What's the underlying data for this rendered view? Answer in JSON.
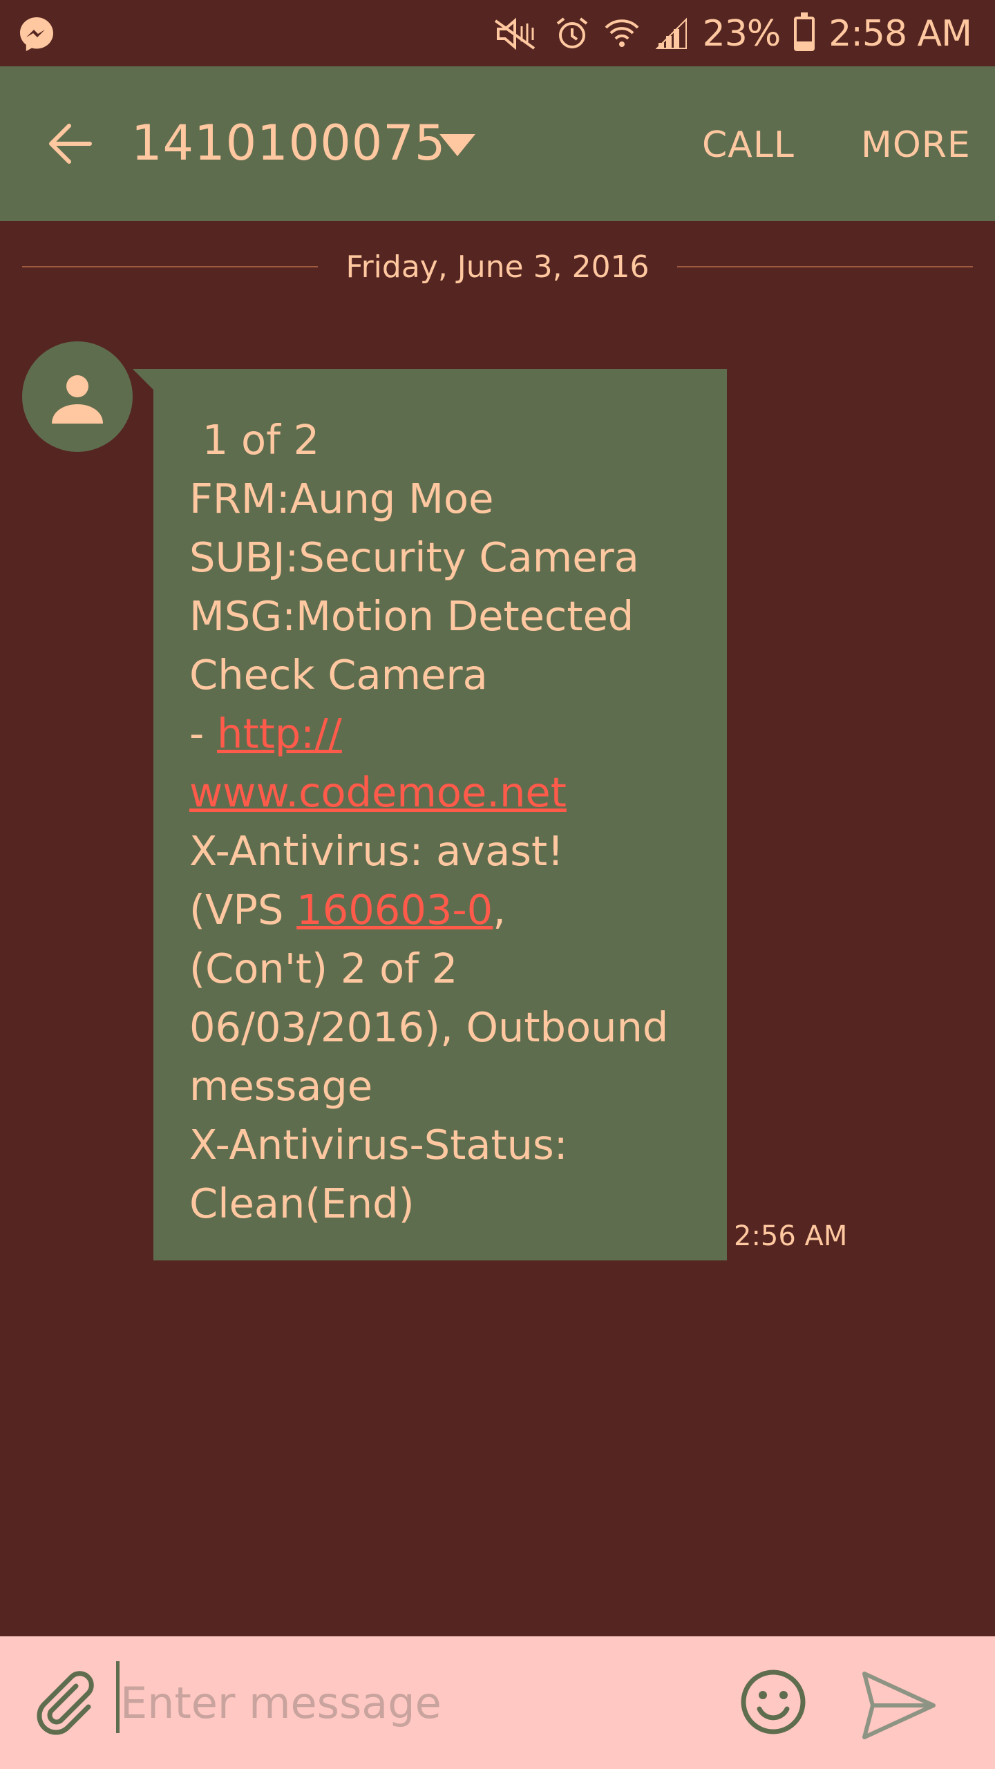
{
  "status_bar": {
    "battery_percent": "23%",
    "time": "2:58 AM",
    "icons": [
      "messenger-icon",
      "mute-icon",
      "alarm-icon",
      "wifi-icon",
      "signal-icon",
      "battery-icon"
    ]
  },
  "toolbar": {
    "title": "1410100075",
    "call_label": "CALL",
    "more_label": "MORE"
  },
  "conversation": {
    "date": "Friday, June 3, 2016",
    "message": {
      "line1": " 1 of 2",
      "line2": "FRM:Aung Moe",
      "line3": "SUBJ:Security Camera",
      "line4": "MSG:Motion Detected",
      "line5": "Check Camera",
      "line6_prefix": "- ",
      "link1_part1": "http://",
      "link1_part2": "www.codemoe.net",
      "line8": "X-Antivirus: avast!",
      "line9_prefix": "(VPS ",
      "link2": "160603-0",
      "line9_suffix": ",",
      "line10": "(Con't) 2 of 2",
      "line11": "06/03/2016), Outbound",
      "line12": "message",
      "line13": "X-Antivirus-Status:",
      "line14": "Clean(End)"
    },
    "time": "2:56 AM"
  },
  "composer": {
    "placeholder": "Enter message"
  },
  "colors": {
    "background": "#552621",
    "toolbar": "#5f6d4f",
    "text": "#ffc8a0",
    "link": "#ff5a4a",
    "composer": "#ffc8c2"
  }
}
